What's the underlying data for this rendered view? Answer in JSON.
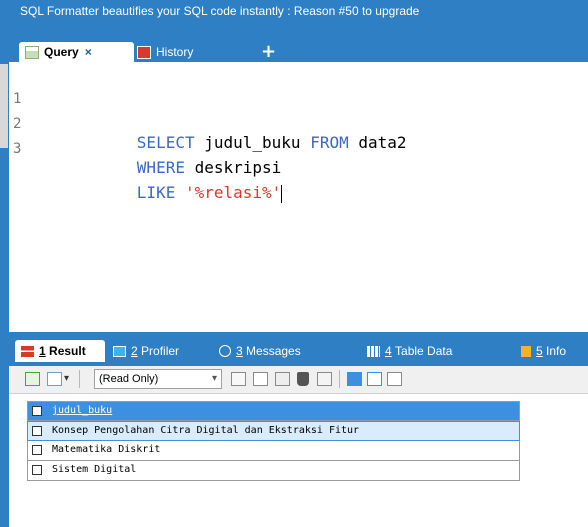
{
  "banner": {
    "text": "SQL Formatter beautifies your SQL code instantly : Reason #50 to upgrade"
  },
  "tabs": {
    "query_label": "Query",
    "close_glyph": "×",
    "history_label": "History",
    "add_glyph": "+"
  },
  "editor": {
    "lines": [
      {
        "num": "1",
        "kw1": "SELECT",
        "ident1": " judul_buku ",
        "kw2": "FROM",
        "ident2": " data2"
      },
      {
        "num": "2",
        "kw1": "WHERE",
        "ident1": " deskripsi"
      },
      {
        "num": "3",
        "kw1": "LIKE",
        "str": " '%relasi%'"
      }
    ]
  },
  "result_tabs": [
    {
      "num": "1",
      "label": "Result"
    },
    {
      "num": "2",
      "label": "Profiler"
    },
    {
      "num": "3",
      "label": "Messages"
    },
    {
      "num": "4",
      "label": "Table Data"
    },
    {
      "num": "5",
      "label": "Info"
    }
  ],
  "toolbar": {
    "mode_value": "(Read Only)",
    "dropdown_arrow": "▾"
  },
  "grid": {
    "header": "judul_buku",
    "rows": [
      "Konsep Pengolahan Citra Digital dan Ekstraksi Fitur",
      "Matematika Diskrit",
      "Sistem Digital"
    ]
  },
  "colors": {
    "chrome_blue": "#2e7fc4",
    "keyword": "#3d67c7",
    "string": "#d6392e",
    "grid_header": "#3d8fe0",
    "selected_row": "#d8ecfb"
  }
}
